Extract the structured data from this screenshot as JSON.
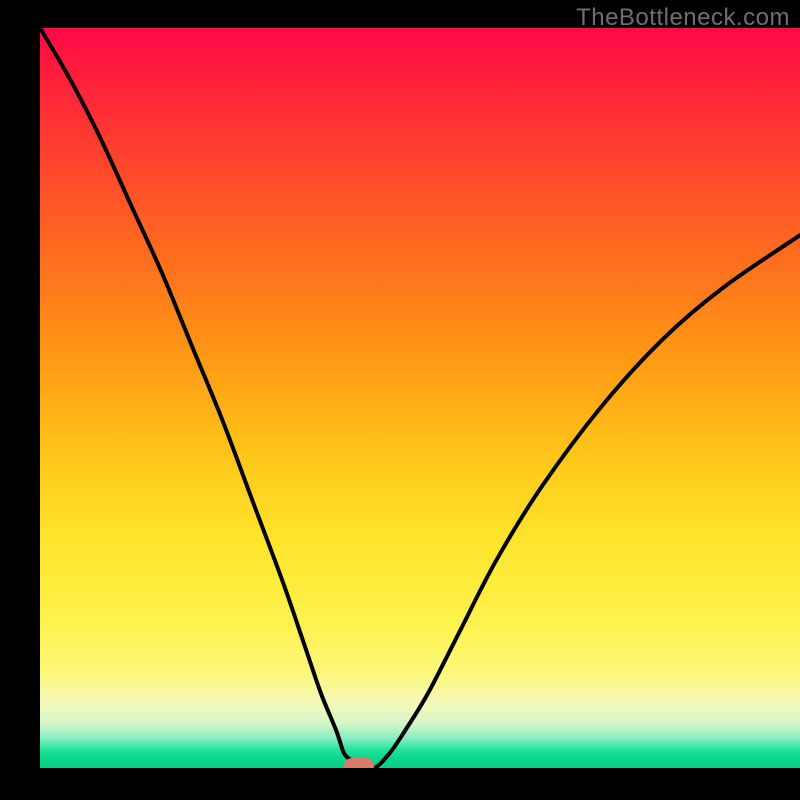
{
  "watermark": "TheBottleneck.com",
  "colors": {
    "frame": "#000000",
    "watermark": "#6f6f6f",
    "curve": "#000000",
    "marker": "#d97a6a",
    "gradient_top": "#ff0a45",
    "gradient_bottom": "#06cf84"
  },
  "chart_data": {
    "type": "line",
    "title": "",
    "xlabel": "",
    "ylabel": "",
    "xlim": [
      0,
      100
    ],
    "ylim": [
      0,
      100
    ],
    "annotations": [
      {
        "name": "optimal-marker",
        "x": 42,
        "y": 0
      }
    ],
    "series": [
      {
        "name": "bottleneck-curve",
        "x": [
          0,
          4,
          8,
          12,
          16,
          20,
          24,
          28,
          32,
          35,
          37,
          39,
          40,
          41,
          42,
          44,
          46,
          48,
          51,
          55,
          60,
          66,
          74,
          82,
          90,
          100
        ],
        "y": [
          100,
          93,
          85,
          76,
          67,
          57,
          47,
          36,
          25,
          16,
          10,
          5,
          2,
          1,
          0,
          0,
          2,
          5,
          10,
          18,
          28,
          38,
          49,
          58,
          65,
          72
        ]
      }
    ],
    "background": {
      "type": "vertical-gradient",
      "meaning": "red=high bottleneck, green=balanced",
      "stops": [
        {
          "pct": 0,
          "at_y": 100
        },
        {
          "pct": 100,
          "at_y": 0
        }
      ]
    }
  }
}
